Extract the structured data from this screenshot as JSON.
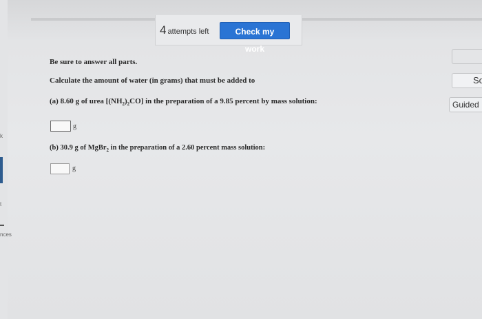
{
  "toolbar": {
    "attempts_count": "4",
    "attempts_label": "attempts left",
    "check_label": "Check my work"
  },
  "right_panel": {
    "btn1_label": "",
    "btn2_label": "So",
    "btn3_label": "Guided"
  },
  "left_panel": {
    "frag1": "k",
    "frag2": "t",
    "frag3": "nces"
  },
  "question": {
    "instruction": "Be sure to answer all parts.",
    "prompt": "Calculate the amount of water (in grams) that must be added to",
    "part_a_prefix": "(a) 8.60 g of urea [(NH",
    "part_a_sub1": "2",
    "part_a_mid": ")",
    "part_a_sub2": "2",
    "part_a_suffix": "CO] in the preparation of a 9.85 percent by mass solution:",
    "part_a_value": "",
    "part_a_unit": "g",
    "part_b_prefix": "(b) 30.9 g of MgBr",
    "part_b_sub": "2",
    "part_b_suffix": " in the preparation of a 2.60 percent mass solution:",
    "part_b_value": "",
    "part_b_unit": "g"
  },
  "colors": {
    "accent": "#2a74d4",
    "background": "#e3e4e6"
  }
}
